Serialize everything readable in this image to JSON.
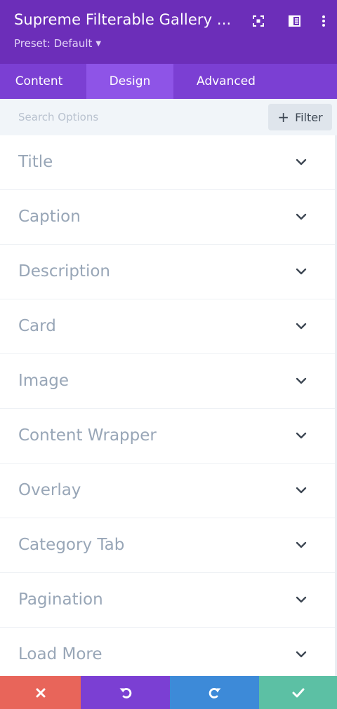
{
  "header": {
    "title": "Supreme Filterable Gallery ...",
    "preset_label": "Preset: Default",
    "icons": [
      "fullscreen-icon",
      "columns-icon",
      "more-vertical-icon"
    ]
  },
  "tabs": [
    {
      "label": "Content",
      "active": false
    },
    {
      "label": "Design",
      "active": true
    },
    {
      "label": "Advanced",
      "active": false
    }
  ],
  "search": {
    "placeholder": "Search Options",
    "value": "",
    "filter_label": "Filter"
  },
  "sections": [
    {
      "label": "Title"
    },
    {
      "label": "Caption"
    },
    {
      "label": "Description"
    },
    {
      "label": "Card"
    },
    {
      "label": "Image"
    },
    {
      "label": "Content Wrapper"
    },
    {
      "label": "Overlay"
    },
    {
      "label": "Category Tab"
    },
    {
      "label": "Pagination"
    },
    {
      "label": "Load More"
    }
  ],
  "footer": {
    "buttons": [
      {
        "icon": "close-icon",
        "color": "#e8655a"
      },
      {
        "icon": "undo-icon",
        "color": "#7b3fd3"
      },
      {
        "icon": "redo-icon",
        "color": "#3d8ad8"
      },
      {
        "icon": "check-icon",
        "color": "#5cc0a4"
      }
    ]
  },
  "colors": {
    "header_bg": "#6c2eb9",
    "tabs_bg": "#7b3fd3",
    "active_tab_bg": "#8e54e7"
  }
}
